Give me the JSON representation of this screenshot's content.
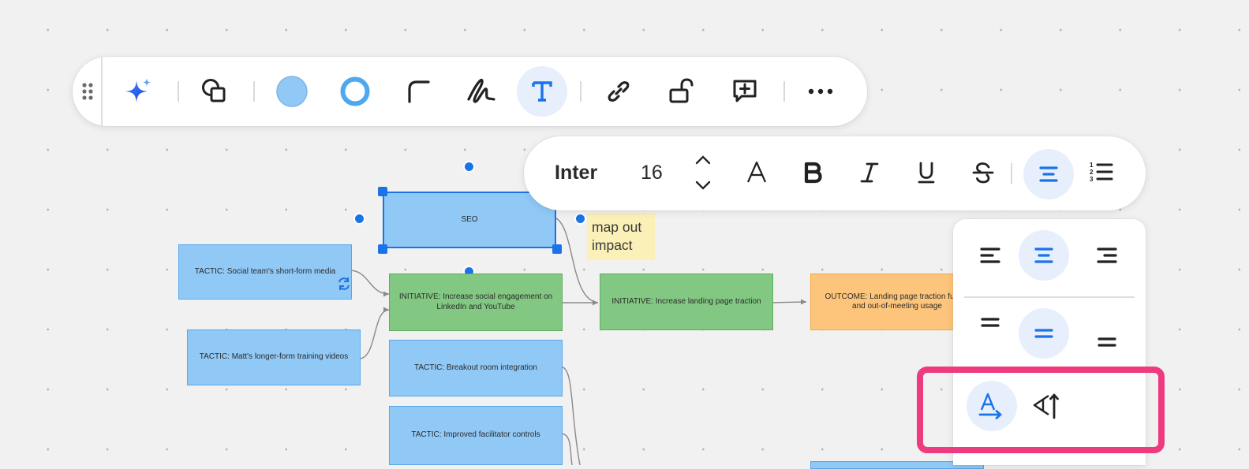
{
  "toolbar": {
    "items": [
      {
        "name": "drag-handle-icon"
      },
      {
        "name": "ai-sparkle-icon"
      },
      {
        "name": "shapes-icon"
      },
      {
        "name": "fill-color-icon",
        "color": "#90c8f6"
      },
      {
        "name": "border-color-icon",
        "color": "#4da8f0"
      },
      {
        "name": "corner-style-icon"
      },
      {
        "name": "pen-icon"
      },
      {
        "name": "text-icon",
        "active": true
      },
      {
        "name": "link-icon"
      },
      {
        "name": "lock-icon"
      },
      {
        "name": "add-comment-icon"
      },
      {
        "name": "more-icon"
      }
    ]
  },
  "text_toolbar": {
    "font": "Inter",
    "size": "16",
    "active_color": "#1a73e8"
  },
  "align_panel": {
    "horizontal": [
      "align-left",
      "align-center",
      "align-right"
    ],
    "vertical": [
      "align-top",
      "align-middle",
      "align-bottom"
    ],
    "direction": [
      "text-horizontal",
      "text-vertical"
    ],
    "highlight_color": "#ee3a7e"
  },
  "canvas": {
    "seo": "SEO",
    "sticky": "map out impact",
    "tactic_social": "TACTIC: Social team's short-form media",
    "tactic_matt": "TACTIC: Matt's longer-form training videos",
    "initiative_social": "INITIATIVE: Increase social engagement on LinkedIn and YouTube",
    "initiative_landing": "INITIATIVE: Increase landing page traction",
    "outcome": "OUTCOME: Landing page traction funnel and out-of-meeting usage",
    "tactic_breakout": "TACTIC: Breakout room integration",
    "tactic_facilitator": "TACTIC: Improved facilitator controls"
  }
}
